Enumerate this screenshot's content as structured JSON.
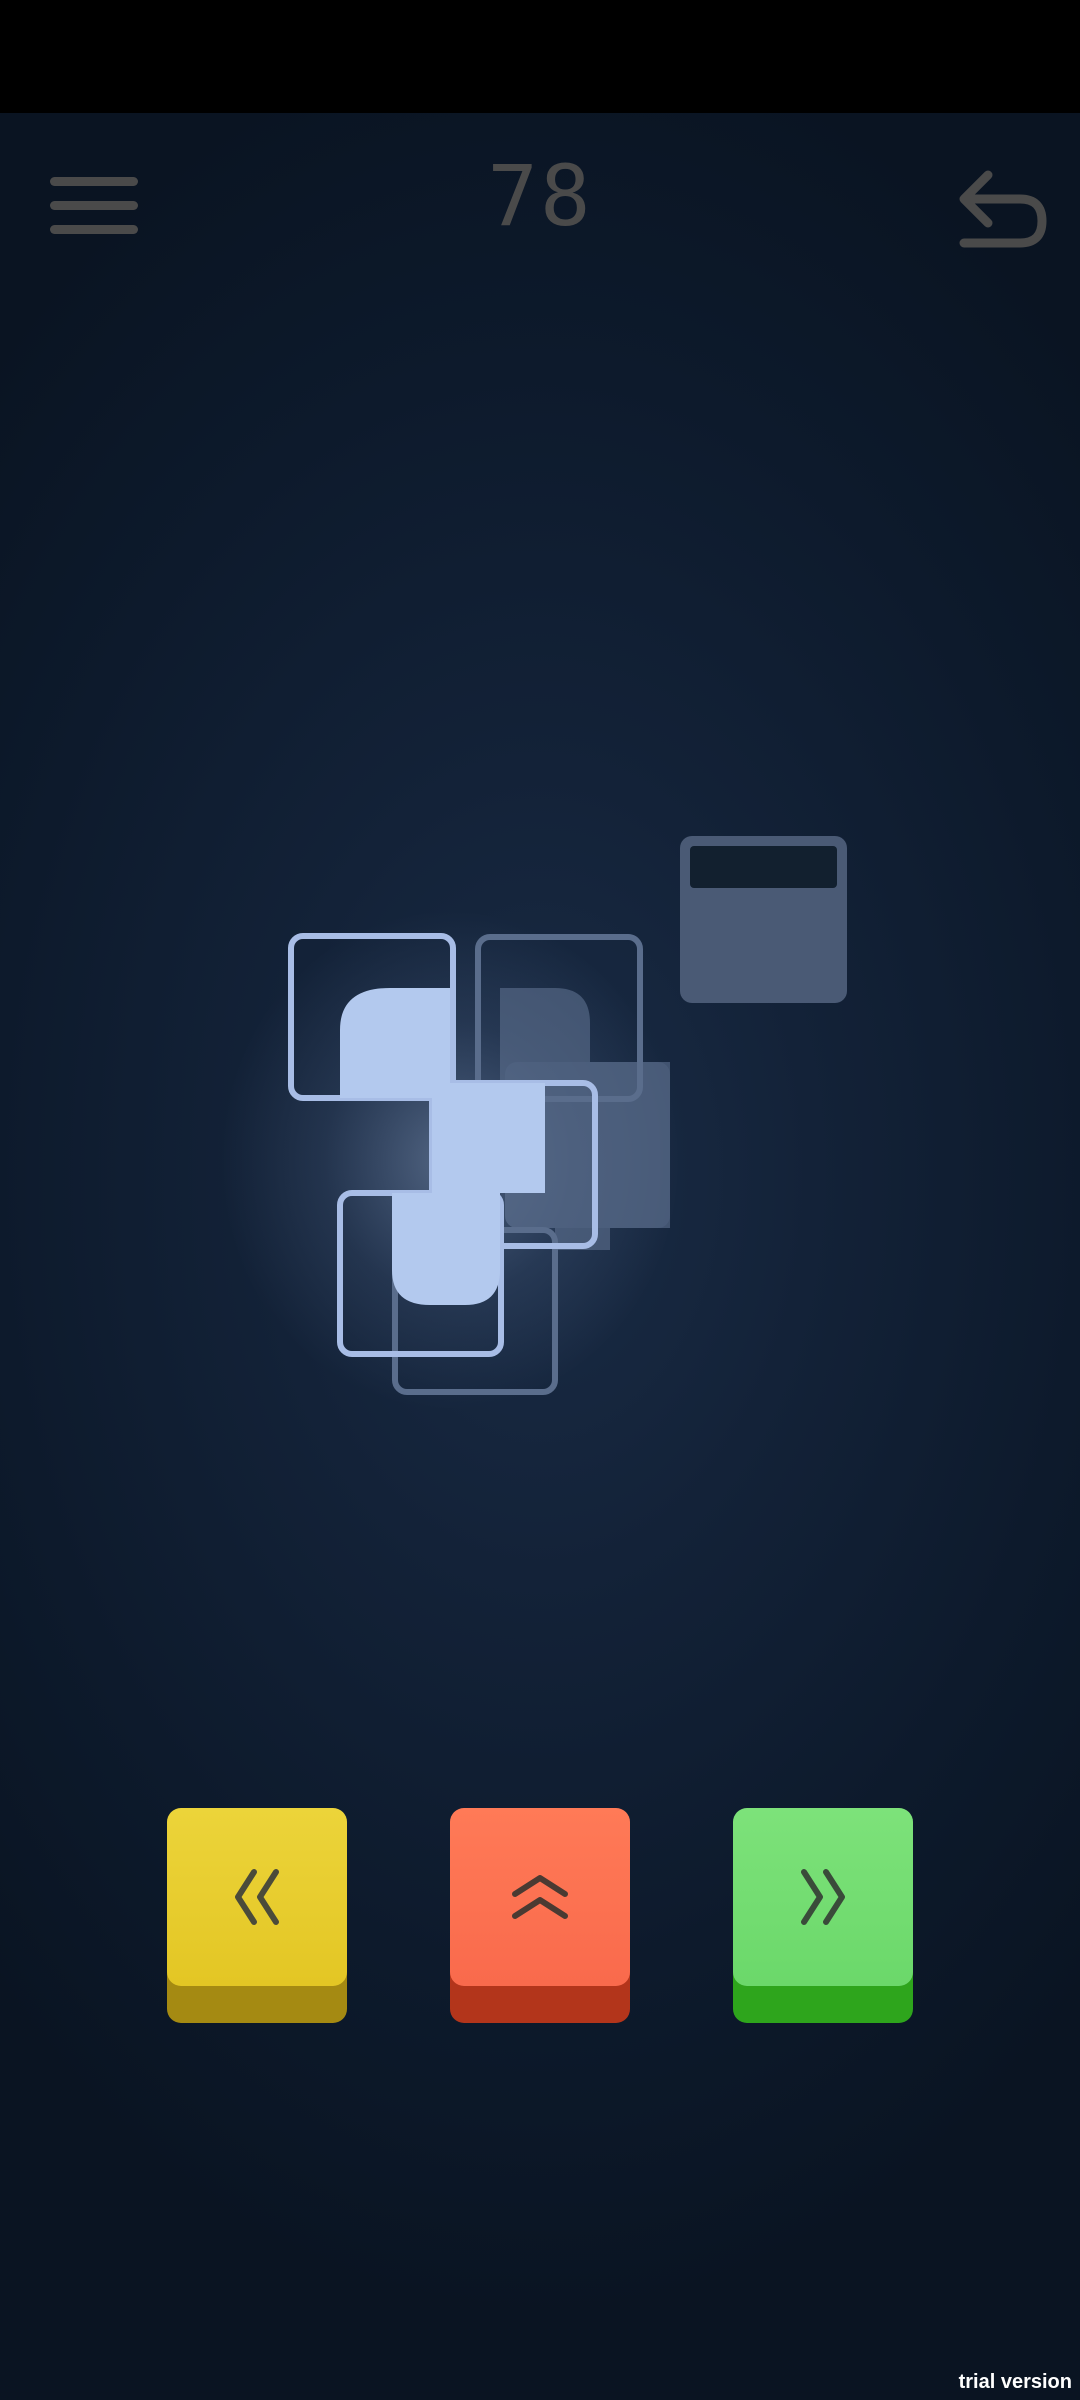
{
  "header": {
    "move_count": "78",
    "menu_icon": "hamburger-menu-icon",
    "undo_icon": "undo-arrow-icon"
  },
  "controls": {
    "left_icon": "double-chevron-left-icon",
    "up_icon": "double-chevron-up-icon",
    "right_icon": "double-chevron-right-icon",
    "left_color": "#e6c92b",
    "up_color": "#fb6f50",
    "right_color": "#72dc70"
  },
  "board": {
    "active_piece_color": "#b3c9ee",
    "ghost_piece_color": "#5a6d8c",
    "target_block_color": "#4a5a75"
  },
  "footer": {
    "trial_label": "trial version"
  },
  "colors": {
    "background": "#132238",
    "status_bar": "#000000",
    "icon_gray": "#4a4a4a"
  }
}
